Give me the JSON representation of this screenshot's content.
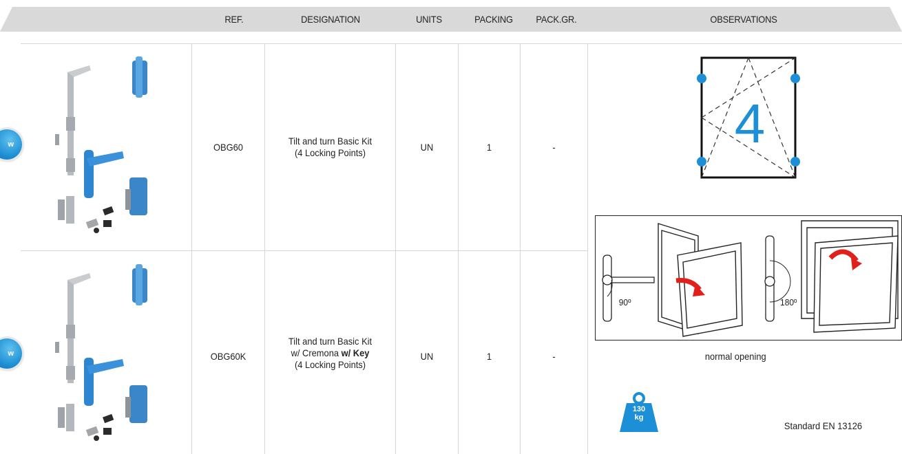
{
  "table": {
    "headers": {
      "ref": "REF.",
      "designation": "DESIGNATION",
      "units": "UNITS",
      "packing": "PACKING",
      "pack_gr": "PACK.GR.",
      "observations": "OBSERVATIONS"
    },
    "rows": [
      {
        "ref": "OBG60",
        "designation_lines": [
          "Tilt and turn Basic Kit",
          "(4 Locking Points)"
        ],
        "units": "UN",
        "packing": "1",
        "pack_gr": "-",
        "badge": "w"
      },
      {
        "ref": "OBG60K",
        "designation_line1": "Tilt and turn Basic Kit",
        "designation_line2_plain": "w/ Cremona ",
        "designation_line2_bold": "w/ Key",
        "designation_line3": "(4 Locking Points)",
        "units": "UN",
        "packing": "1",
        "pack_gr": "-",
        "badge": "w"
      }
    ]
  },
  "observations": {
    "locking_points": "4",
    "angle_turn": "90º",
    "angle_tilt": "180º",
    "opening_caption": "normal opening",
    "weight_value": "130",
    "weight_unit": "kg",
    "standard": "Standard EN 13126"
  },
  "colors": {
    "header_bg": "#d9d9d9",
    "accent_blue": "#1c8fd6",
    "arrow_red": "#e0201b",
    "grid_line": "#d6d6d6"
  }
}
